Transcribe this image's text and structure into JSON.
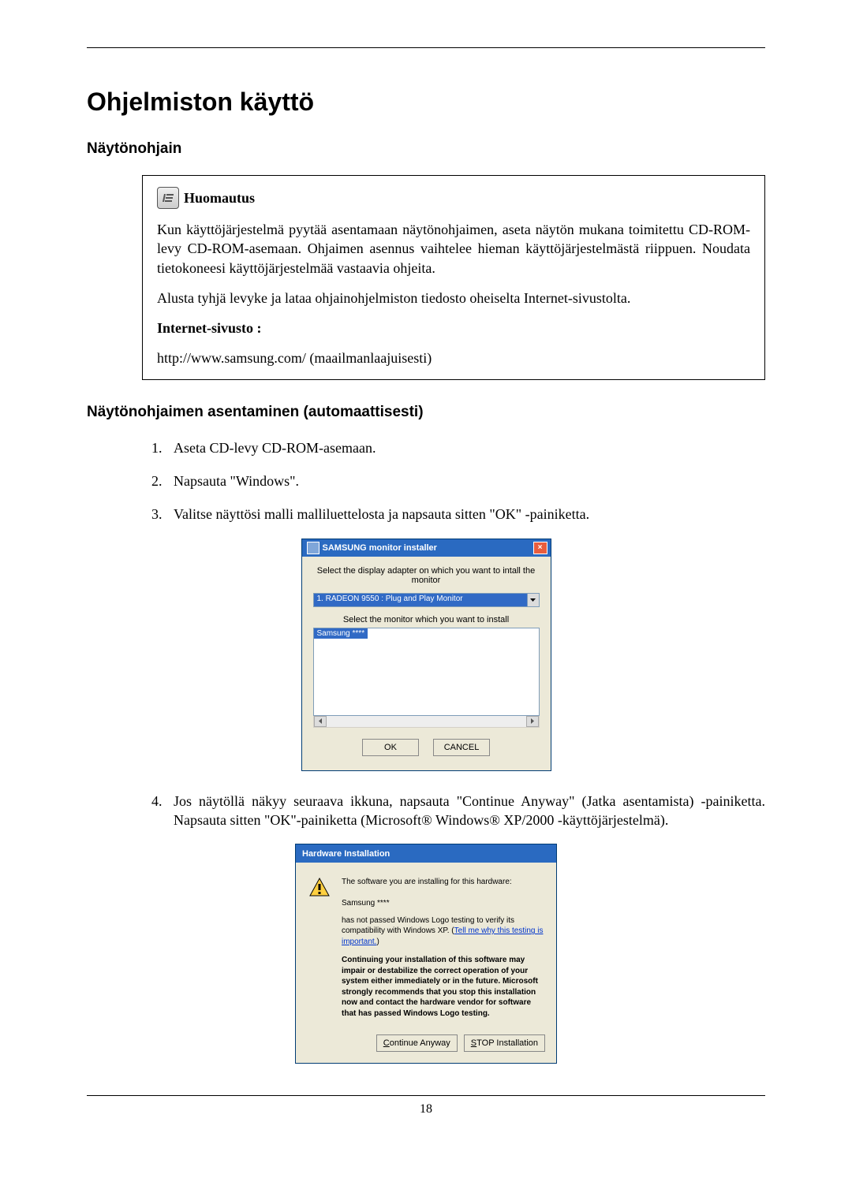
{
  "doc": {
    "title": "Ohjelmiston käyttö",
    "section1": "Näytönohjain",
    "note": {
      "heading": "Huomautus",
      "p1": "Kun käyttöjärjestelmä pyytää asentamaan näytönohjaimen, aseta näytön mukana toimitettu CD-ROM-levy CD-ROM-asemaan. Ohjaimen asennus vaihtelee hieman käyttöjärjestelmästä riippuen. Noudata tietokoneesi käyttöjärjestelmää vastaavia ohjeita.",
      "p2": "Alusta tyhjä levyke ja lataa ohjainohjelmiston tiedosto oheiselta Internet-sivustolta.",
      "label": "Internet-sivusto :",
      "url": "http://www.samsung.com/ (maailmanlaajuisesti)"
    },
    "section2": "Näytönohjaimen asentaminen (automaattisesti)",
    "steps": [
      "Aseta CD-levy CD-ROM-asemaan.",
      "Napsauta \"Windows\".",
      "Valitse näyttösi malli malliluettelosta ja napsauta sitten \"OK\" -painiketta.",
      "Jos näytöllä näkyy seuraava ikkuna, napsauta \"Continue Anyway\" (Jatka asentamista) -painiketta. Napsauta sitten \"OK\"-painiketta (Microsoft® Windows® XP/2000 -käyttöjärjestelmä)."
    ],
    "page_number": "18"
  },
  "dlg1": {
    "title": "SAMSUNG monitor installer",
    "instr1": "Select the display adapter on which you want to intall the monitor",
    "dropdown_sel": "1. RADEON 9550 : Plug and Play Monitor",
    "instr2": "Select the monitor which you want to install",
    "list_sel": "Samsung ****",
    "ok": "OK",
    "cancel": "CANCEL"
  },
  "dlg2": {
    "title": "Hardware Installation",
    "p1a": "The software you are installing for this hardware:",
    "p1b": "Samsung ****",
    "p2a": "has not passed Windows Logo testing to verify its compatibility with Windows XP. (",
    "p2link": "Tell me why this testing is important.",
    "p2b": ")",
    "warn": "Continuing your installation of this software may impair or destabilize the correct operation of your system either immediately or in the future. Microsoft strongly recommends that you stop this installation now and contact the hardware vendor for software that has passed Windows Logo testing.",
    "btn_continue_c": "C",
    "btn_continue_rest": "ontinue Anyway",
    "btn_stop_s": "S",
    "btn_stop_rest": "TOP Installation"
  }
}
